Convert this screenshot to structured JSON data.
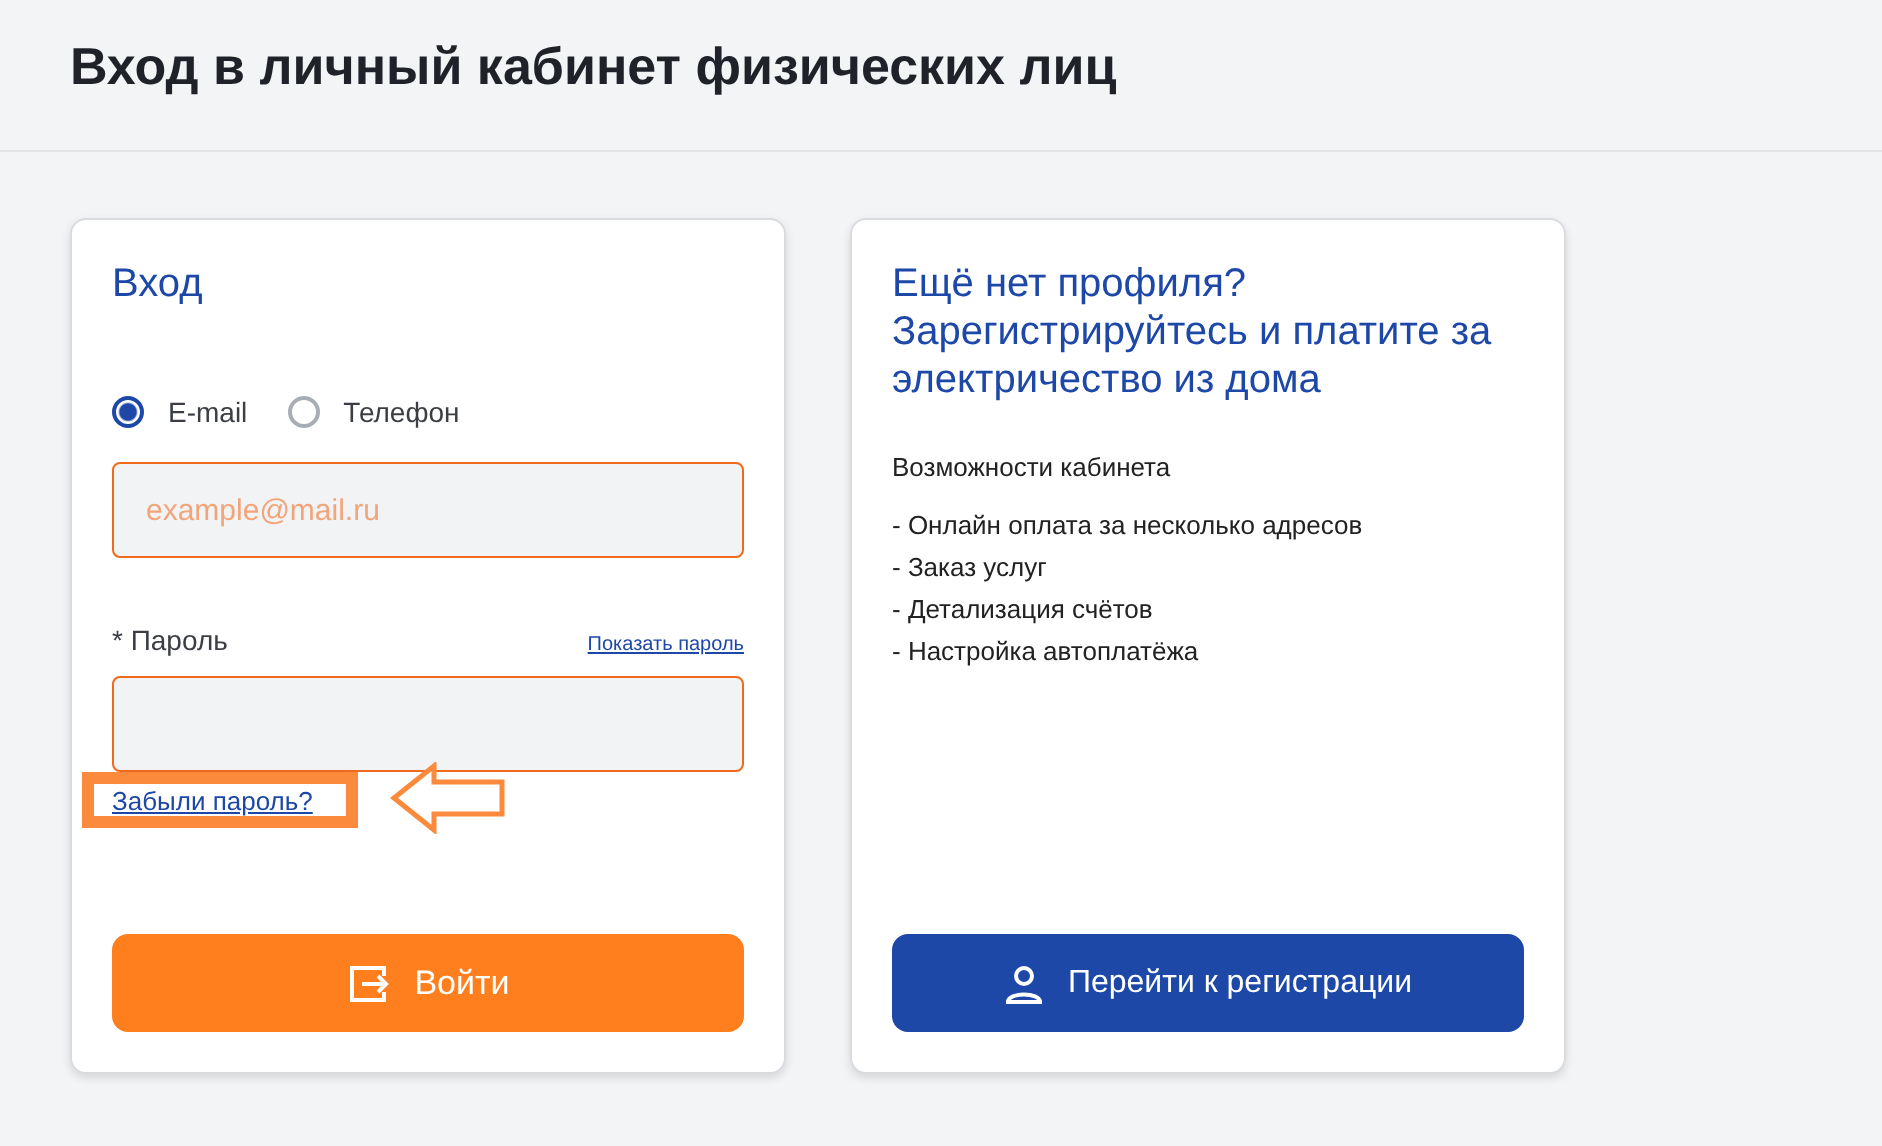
{
  "page_title": "Вход в личный кабинет физических лиц",
  "login": {
    "title": "Вход",
    "login_types": [
      {
        "label": "E-mail",
        "selected": true
      },
      {
        "label": "Телефон",
        "selected": false
      }
    ],
    "email_field": {
      "placeholder": "example@mail.ru"
    },
    "password_label": "* Пароль",
    "show_password_link": "Показать пароль",
    "forgot_link": "Забыли пароль?",
    "forgot_highlighted": true,
    "submit_button": "Войти"
  },
  "register": {
    "title": "Ещё нет профиля? Зарегистрируйтесь и платите за электричество из дома",
    "features_title": "Возможности кабинета",
    "features": [
      "- Онлайн оплата за несколько адресов",
      "- Заказ услуг",
      "- Детализация счётов",
      "- Настройка автоплатёжа"
    ],
    "button": "Перейти к регистрации"
  }
}
